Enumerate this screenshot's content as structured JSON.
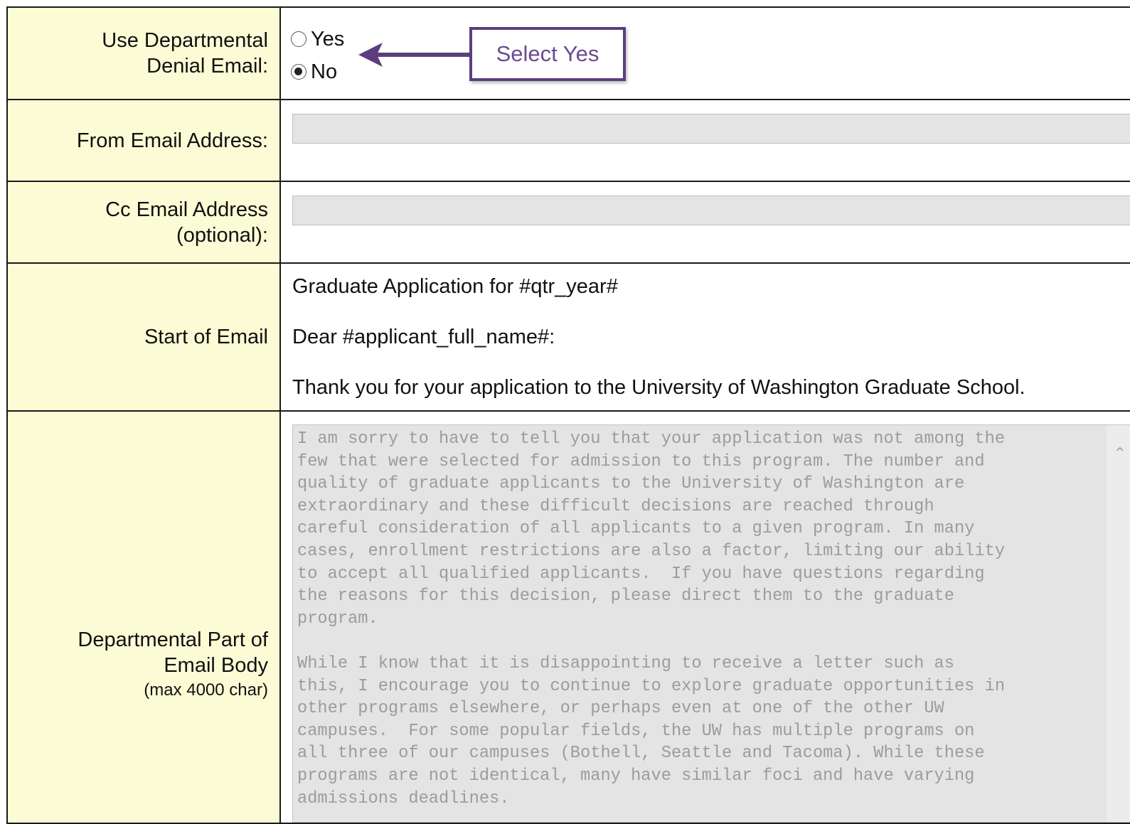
{
  "rows": {
    "denial": {
      "label_line1": "Use Departmental",
      "label_line2": "Denial Email:",
      "options": [
        {
          "label": "Yes",
          "checked": false
        },
        {
          "label": "No",
          "checked": true
        }
      ],
      "callout": "Select Yes",
      "callout_color": "#5b3e7f"
    },
    "from": {
      "label": "From Email Address:",
      "value": ""
    },
    "cc": {
      "label_line1": "Cc Email Address",
      "label_line2": "(optional):",
      "value": ""
    },
    "start": {
      "label": "Start of Email",
      "lines": [
        "Graduate Application for #qtr_year#",
        "Dear #applicant_full_name#:",
        "Thank you for your application to the University of Washington Graduate School."
      ]
    },
    "body": {
      "label_line1": "Departmental Part of",
      "label_line2": "Email Body",
      "label_sub": "(max 4000 char)",
      "text": "I am sorry to have to tell you that your application was not among the\nfew that were selected for admission to this program. The number and\nquality of graduate applicants to the University of Washington are\nextraordinary and these difficult decisions are reached through\ncareful consideration of all applicants to a given program. In many\ncases, enrollment restrictions are also a factor, limiting our ability\nto accept all qualified applicants.  If you have questions regarding\nthe reasons for this decision, please direct them to the graduate\nprogram.\n\nWhile I know that it is disappointing to receive a letter such as\nthis, I encourage you to continue to explore graduate opportunities in\nother programs elsewhere, or perhaps even at one of the other UW\ncampuses.  For some popular fields, the UW has multiple programs on\nall three of our campuses (Bothell, Seattle and Tacoma). While these\nprograms are not identical, many have similar foci and have varying\nadmissions deadlines."
    }
  },
  "colors": {
    "label_bg": "#fbfbd6",
    "field_bg": "#e4e4e4",
    "border": "#1a1a1a"
  }
}
